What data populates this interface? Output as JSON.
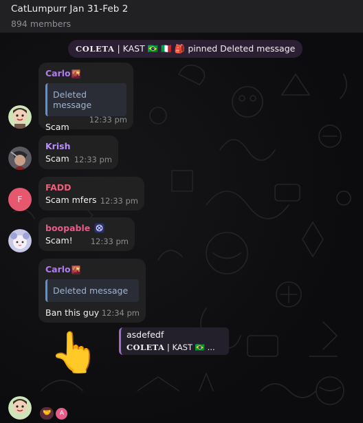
{
  "header": {
    "title": "CatLumpurr Jan 31-Feb 2",
    "member_count": "894 members"
  },
  "service_message": {
    "actor": "COLETA",
    "actor_rest": " | KAST 🇧🇷 🇮🇹 🎒 ",
    "action": "pinned Deleted message"
  },
  "messages": [
    {
      "sender": "Carlo",
      "sender_emoji": "🌇",
      "sender_color": "#b07cf0",
      "reply": "Deleted message",
      "text": "Scam",
      "time": "12:33 pm"
    },
    {
      "sender": "Krish",
      "sender_emoji": "",
      "sender_color": "#b890ff",
      "reply": "",
      "text": "Scam",
      "time": "12:33 pm"
    },
    {
      "sender": "FADD",
      "sender_emoji": "",
      "sender_color": "#e8607c",
      "reply": "",
      "text": "Scam mfers",
      "time": "12:33 pm"
    },
    {
      "sender": "boopable",
      "sender_emoji": "🔗",
      "sender_color": "#e85a8c",
      "reply": "",
      "text": "Scam!",
      "time": "12:33 pm"
    },
    {
      "sender": "Carlo",
      "sender_emoji": "🌇",
      "sender_color": "#b07cf0",
      "reply": "Deleted message",
      "text": "Ban this guy",
      "time": "12:34 pm"
    }
  ],
  "avatars": {
    "fadd_letter": "F"
  },
  "pinned_bar": {
    "line1": "asdefedf",
    "actor": "COLETA",
    "actor_rest": " | KAST 🇧🇷 ..."
  },
  "pointer_emoji": "👆",
  "reactions": {
    "emoji": "🤝",
    "avatar_letter": "A"
  },
  "colors": {
    "header_bg": "#212123",
    "bubble_bg": "#212121",
    "service_bg": "#2b1f33",
    "reply_bar": "#6f8fb8"
  }
}
